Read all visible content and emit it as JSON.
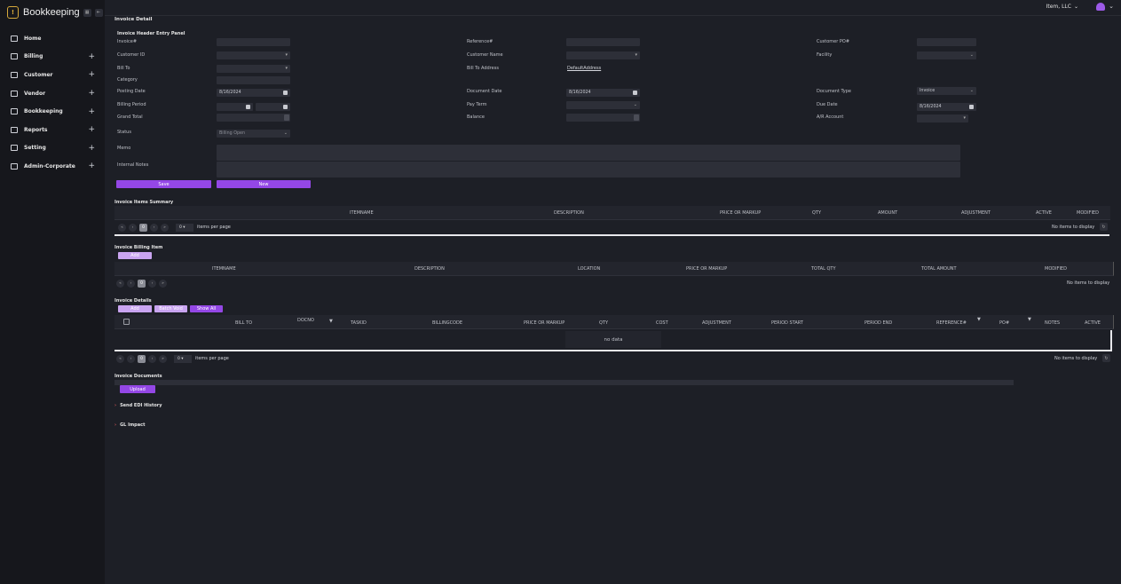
{
  "app": {
    "title": "Bookkeeping",
    "company": "Item, LLC"
  },
  "sidebar": {
    "items": [
      {
        "label": "Home",
        "expandable": false
      },
      {
        "label": "Billing",
        "expandable": true
      },
      {
        "label": "Customer",
        "expandable": true
      },
      {
        "label": "Vendor",
        "expandable": true
      },
      {
        "label": "Bookkeeping",
        "expandable": true
      },
      {
        "label": "Reports",
        "expandable": true
      },
      {
        "label": "Setting",
        "expandable": true
      },
      {
        "label": "Admin-Corporate",
        "expandable": true
      }
    ]
  },
  "page": {
    "title": "Invoice Detail"
  },
  "header_panel": {
    "title": "Invoice Header Entry Panel",
    "invoice_label": "Invoice#",
    "reference_label": "Reference#",
    "customer_po_label": "Customer PO#",
    "customer_id_label": "Customer ID",
    "customer_name_label": "Customer Name",
    "facility_label": "Facility",
    "bill_to_label": "Bill To",
    "bill_to_address_label": "Bill To Address",
    "bill_to_address_link": "DefaultAddress",
    "category_label": "Category",
    "posting_date_label": "Posting Date",
    "posting_date": "8/16/2024",
    "document_date_label": "Document Date",
    "document_date": "8/16/2024",
    "document_type_label": "Document Type",
    "document_type": "Invoice",
    "billing_period_label": "Billing Period",
    "pay_term_label": "Pay Term",
    "due_date_label": "Due Date",
    "due_date": "8/16/2024",
    "grand_total_label": "Grand Total",
    "balance_label": "Balance",
    "ar_account_label": "A/R Account",
    "status_label": "Status",
    "status": "Billing Open",
    "memo_label": "Memo",
    "internal_notes_label": "Internal Notes",
    "save": "Save",
    "new": "New"
  },
  "items_summary": {
    "title": "Invoice Items Summary",
    "columns": [
      "ITEMNAME",
      "DESCRIPTION",
      "PRICE OR MARKUP",
      "QTY",
      "AMOUNT",
      "ADJUSTMENT",
      "ACTIVE",
      "MODIFIED"
    ],
    "page": "0",
    "per_page": "0",
    "per_page_label": "items per page",
    "empty": "No items to display"
  },
  "billing_item": {
    "title": "Invoice Billing Item",
    "add": "Add",
    "columns": [
      "ITEMNAME",
      "DESCRIPTION",
      "LOCATION",
      "PRICE OR MARKUP",
      "TOTAL QTY",
      "TOTAL AMOUNT",
      "MODIFIED"
    ],
    "page": "0",
    "empty": "No items to display"
  },
  "details": {
    "title": "Invoice Details",
    "add": "Add",
    "batch_void": "Batch Void",
    "show_all": "Show All",
    "columns": [
      "BILL TO",
      "DOCNO",
      "TASKID",
      "BILLINGCODE",
      "PRICE OR MARKUP",
      "QTY",
      "COST",
      "ADJUSTMENT",
      "PERIOD START",
      "PERIOD END",
      "REFERENCE#",
      "PO#",
      "NOTES",
      "ACTIVE"
    ],
    "no_data": "no data",
    "page": "0",
    "per_page": "0",
    "per_page_label": "items per page",
    "empty": "No items to display"
  },
  "documents": {
    "title": "Invoice Documents",
    "upload": "Upload"
  },
  "collapsibles": {
    "edi": "Send EDI History",
    "gl": "GL Impact"
  },
  "pager_icons": {
    "first": "«",
    "prev": "‹",
    "next": "›",
    "last": "»"
  },
  "colors": {
    "accent": "#9447e6",
    "accent_light": "#c9a4f0",
    "bg": "#1d1f26",
    "sidebar": "#16171c",
    "input": "#2d2f38"
  }
}
